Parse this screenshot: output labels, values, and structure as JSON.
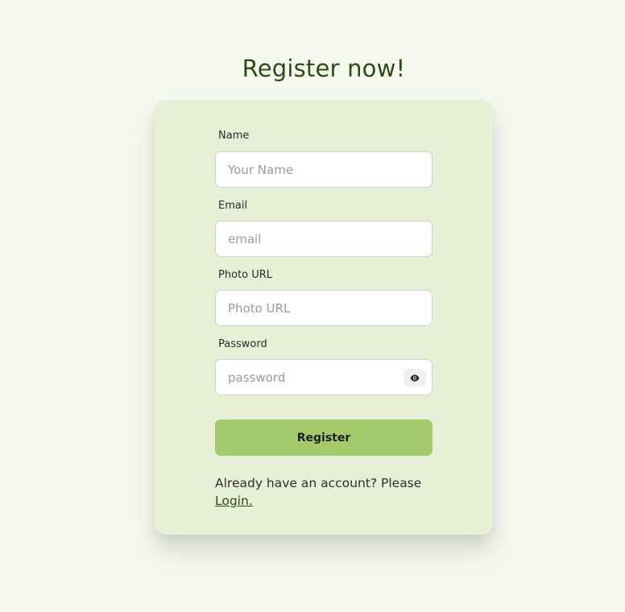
{
  "page": {
    "title": "Register now!"
  },
  "form": {
    "name": {
      "label": "Name",
      "placeholder": "Your Name",
      "value": ""
    },
    "email": {
      "label": "Email",
      "placeholder": "email",
      "value": ""
    },
    "photo": {
      "label": "Photo URL",
      "placeholder": "Photo URL",
      "value": ""
    },
    "password": {
      "label": "Password",
      "placeholder": "password",
      "value": "",
      "toggle_icon": "eye-icon"
    },
    "submit_label": "Register"
  },
  "footer": {
    "text": "Already have an account? Please",
    "link_label": "Login."
  },
  "colors": {
    "background": "#f5f8ef",
    "card": "#e6f0d6",
    "title": "#2f4a12",
    "button": "#a3cb6c"
  }
}
